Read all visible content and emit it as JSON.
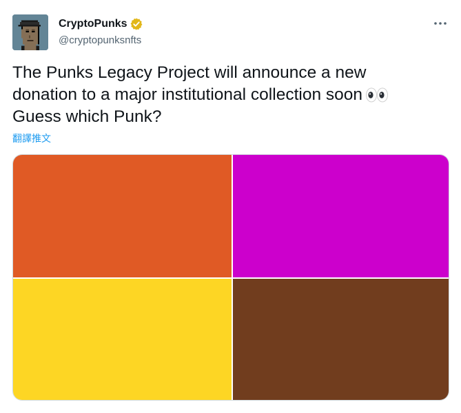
{
  "author": {
    "display_name": "CryptoPunks",
    "handle": "@cryptopunksnfts",
    "verified": true,
    "verified_badge_color": "#e2b719",
    "avatar_background": "#638596"
  },
  "tweet": {
    "lines": [
      "The Punks Legacy Project will announce a new",
      "donation to a major institutional collection soon",
      "Guess which Punk?"
    ],
    "emoji": "eyes-icon"
  },
  "translate_link": "翻譯推文",
  "media": {
    "tiles": [
      {
        "name": "orange",
        "color": "#e05a25"
      },
      {
        "name": "magenta",
        "color": "#cc00cc"
      },
      {
        "name": "yellow",
        "color": "#fdd624"
      },
      {
        "name": "brown",
        "color": "#713d1e"
      }
    ]
  },
  "icons": {
    "more": "more-options-icon",
    "verified": "verified-badge-icon"
  }
}
